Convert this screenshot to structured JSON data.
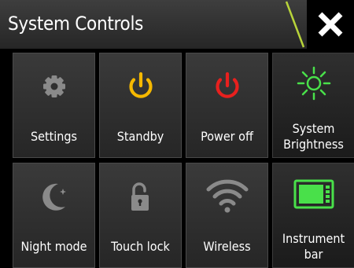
{
  "header": {
    "title": "System Controls",
    "accent_color": "#b8d43a",
    "close_icon": "close-icon"
  },
  "tiles": [
    {
      "label": "Settings",
      "icon": "gear-icon",
      "color": "#8a8a8a"
    },
    {
      "label": "Standby",
      "icon": "power-icon",
      "color": "#f5b800"
    },
    {
      "label": "Power off",
      "icon": "power-icon",
      "color": "#e8201e"
    },
    {
      "label": "System Brightness",
      "icon": "sun-brightness-icon",
      "color": "#49e04a",
      "active": true
    },
    {
      "label": "Night mode",
      "icon": "moon-icon",
      "color": "#8a8a8a"
    },
    {
      "label": "Touch lock",
      "icon": "unlocked-padlock-icon",
      "color": "#8a8a8a"
    },
    {
      "label": "Wireless",
      "icon": "wifi-icon",
      "color": "#8a8a8a"
    },
    {
      "label": "Instrument bar",
      "icon": "instrument-bar-icon",
      "color": "#49e04a",
      "active": true
    }
  ]
}
